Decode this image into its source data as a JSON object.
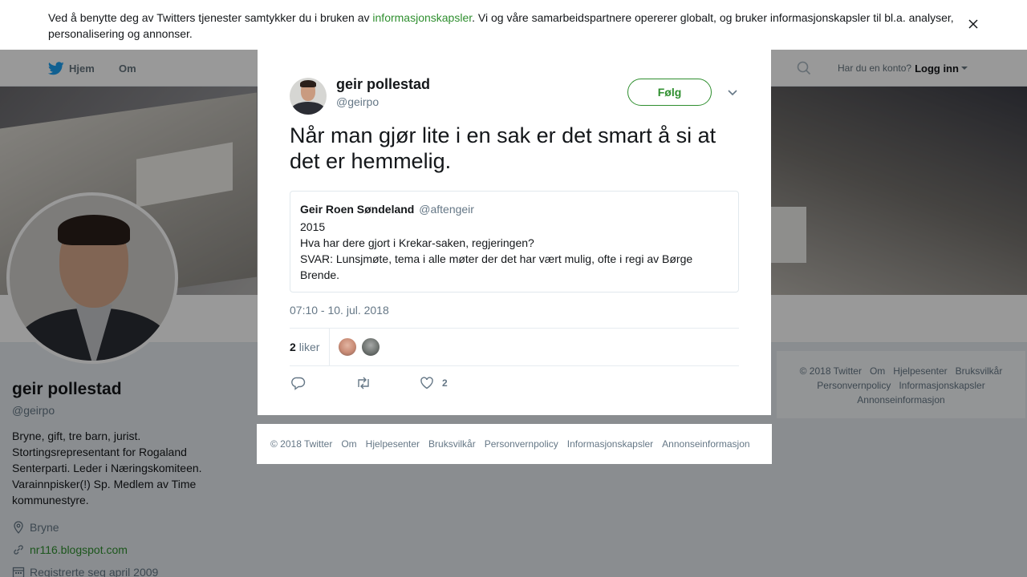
{
  "cookie_banner": {
    "text_before": "Ved å benytte deg av Twitters tjenester samtykker du i bruken av ",
    "link": "informasjonskapsler",
    "text_after": ". Vi og våre samarbeidspartnere opererer globalt, og bruker informasjonskapsler til bl.a. analyser, personalisering og annonser."
  },
  "nav": {
    "home": "Hjem",
    "about": "Om",
    "account_prompt": "Har du en konto?",
    "login": "Logg inn"
  },
  "profile": {
    "name": "geir pollestad",
    "handle": "@geirpo",
    "bio": "Bryne, gift, tre barn, jurist. Stortingsrepresentant for Rogaland Senterparti. Leder i Næringskomiteen. Varainnpisker(!) Sp. Medlem av Time kommunestyre.",
    "location": "Bryne",
    "website": "nr116.blogspot.com",
    "joined": "Registrerte seg april 2009"
  },
  "tweet": {
    "author_name": "geir pollestad",
    "author_handle": "@geirpo",
    "follow_label": "Følg",
    "text": "Når man gjør lite i en sak er det smart å si at det er hemmelig.",
    "quote": {
      "name": "Geir Roen Søndeland",
      "handle": "@aftengeir",
      "lines": [
        "2015",
        "Hva har dere gjort i Krekar-saken, regjeringen?",
        "SVAR: Lunsjmøte, tema i alle møter der det har vært mulig, ofte i regi av Børge Brende."
      ]
    },
    "timestamp": "07:10 - 10. jul. 2018",
    "likes_count": "2",
    "likes_label": "liker",
    "like_action_count": "2"
  },
  "modal_footer": {
    "items": [
      "© 2018 Twitter",
      "Om",
      "Hjelpesenter",
      "Bruksvilkår",
      "Personvernpolicy",
      "Informasjonskapsler",
      "Annonseinformasjon"
    ]
  },
  "right_footer": {
    "items": [
      "© 2018 Twitter",
      "Om",
      "Hjelpesenter",
      "Bruksvilkår",
      "Personvernpolicy",
      "Informasjonskapsler",
      "Annonseinformasjon"
    ]
  },
  "colors": {
    "accent": "#2f8f2f",
    "text": "#14171a",
    "muted": "#657786"
  }
}
